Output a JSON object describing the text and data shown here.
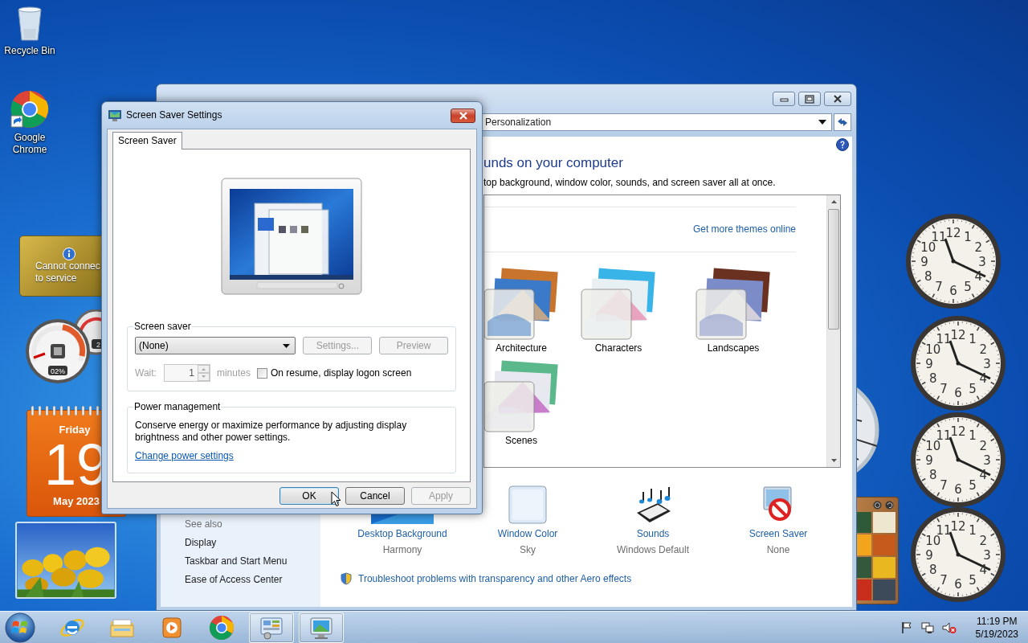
{
  "desktop_icons": [
    {
      "label": "Recycle Bin",
      "kind": "recycle-bin"
    },
    {
      "label": "Google Chrome",
      "kind": "chrome"
    }
  ],
  "gadgets": {
    "weather": {
      "lines": [
        "Cannot connec",
        "to service"
      ]
    },
    "cpu_meter": {
      "reading": "02%",
      "second_reading": "2"
    },
    "calendar": {
      "weekday": "Friday",
      "day": "19",
      "month_year": "May 2023"
    },
    "clocks": [
      {
        "numerals": [
          "12",
          "11",
          "1",
          "10",
          "2",
          "9",
          "3",
          "8",
          "4",
          "7",
          "5",
          "6"
        ]
      },
      {
        "numerals": [
          "12",
          "11",
          "1",
          "10",
          "2",
          "9",
          "3",
          "8",
          "4",
          "7",
          "5",
          "6"
        ]
      },
      {
        "numerals": [
          "12",
          "11",
          "1",
          "10",
          "2",
          "9",
          "3",
          "8",
          "4",
          "7",
          "5",
          "6"
        ]
      },
      {
        "numerals": [
          "12",
          "11",
          "1",
          "10",
          "2",
          "9",
          "3",
          "8",
          "4",
          "7",
          "5",
          "6"
        ]
      }
    ]
  },
  "personalization_window": {
    "address": "Personalization",
    "heading": "unds on your computer",
    "subheading": "top background, window color, sounds, and screen saver all at once.",
    "themes_link": "Get more themes online",
    "themes": [
      {
        "label": "Architecture"
      },
      {
        "label": "Characters"
      },
      {
        "label": "Landscapes"
      },
      {
        "label": "Scenes"
      }
    ],
    "settings": [
      {
        "label": "Desktop Background",
        "value": "Harmony",
        "kind": "background"
      },
      {
        "label": "Window Color",
        "value": "Sky",
        "kind": "color"
      },
      {
        "label": "Sounds",
        "value": "Windows Default",
        "kind": "sounds"
      },
      {
        "label": "Screen Saver",
        "value": "None",
        "kind": "screensaver"
      }
    ],
    "troubleshoot_link": "Troubleshoot problems with transparency and other Aero effects",
    "see_also": {
      "title": "See also",
      "links": [
        "Display",
        "Taskbar and Start Menu",
        "Ease of Access Center"
      ]
    }
  },
  "dialog": {
    "title": "Screen Saver Settings",
    "tabs": [
      {
        "label": "Screen Saver",
        "selected": true
      }
    ],
    "screen_saver_group": {
      "title": "Screen saver",
      "selection": "(None)",
      "buttons": [
        {
          "label": "Settings...",
          "disabled": true
        },
        {
          "label": "Preview",
          "disabled": true
        }
      ],
      "wait_label": "Wait:",
      "wait_value": "1",
      "minutes_label": "minutes",
      "wait_disabled": true,
      "logon_checkbox": {
        "label": "On resume, display logon screen",
        "checked": false
      }
    },
    "power_group": {
      "title": "Power management",
      "text": "Conserve energy or maximize performance by adjusting display brightness and other power settings.",
      "link": "Change power settings"
    },
    "buttons": [
      {
        "label": "OK",
        "default": true,
        "disabled": false
      },
      {
        "label": "Cancel",
        "default": false,
        "disabled": false
      },
      {
        "label": "Apply",
        "default": false,
        "disabled": true
      }
    ]
  },
  "taskbar": {
    "apps": [
      {
        "kind": "ie",
        "active": false
      },
      {
        "kind": "explorer",
        "active": false
      },
      {
        "kind": "media",
        "active": false
      },
      {
        "kind": "chrome",
        "active": false
      },
      {
        "kind": "control-panel",
        "active": true
      },
      {
        "kind": "screensaver",
        "active": true
      }
    ],
    "time": "11:19 PM",
    "date": "5/19/2023"
  }
}
